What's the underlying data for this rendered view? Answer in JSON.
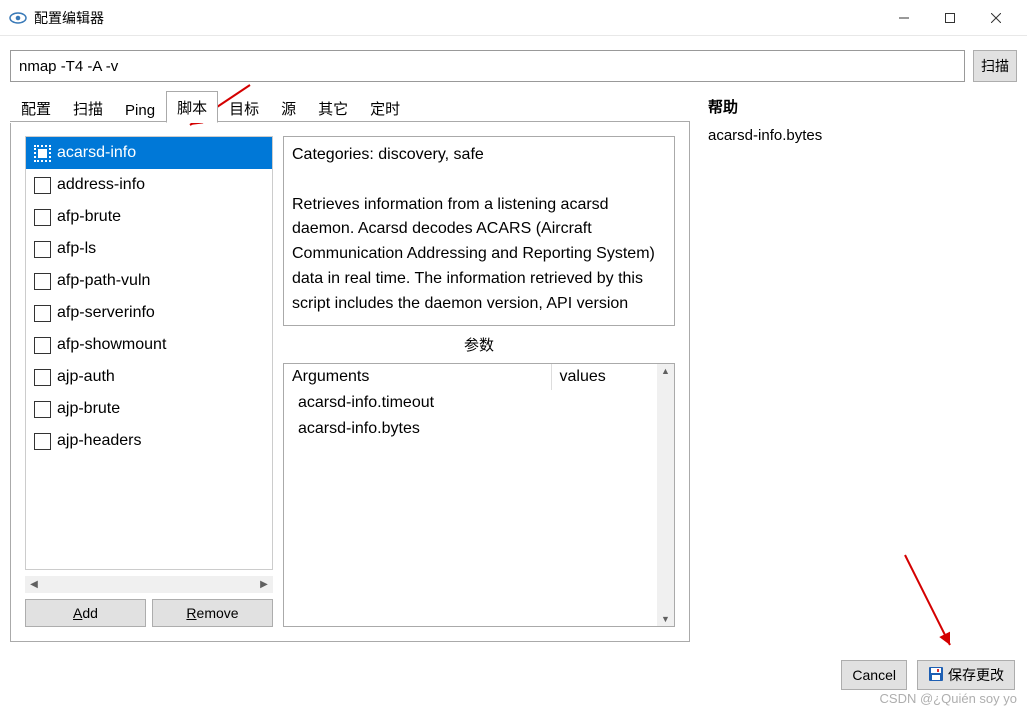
{
  "window": {
    "title": "配置编辑器"
  },
  "command": {
    "value": "nmap -T4 -A -v",
    "scan_label": "扫描"
  },
  "tabs": [
    "配置",
    "扫描",
    "Ping",
    "脚本",
    "目标",
    "源",
    "其它",
    "定时"
  ],
  "active_tab_index": 3,
  "scripts": [
    {
      "name": "acarsd-info",
      "selected": true
    },
    {
      "name": "address-info"
    },
    {
      "name": "afp-brute"
    },
    {
      "name": "afp-ls"
    },
    {
      "name": "afp-path-vuln"
    },
    {
      "name": "afp-serverinfo"
    },
    {
      "name": "afp-showmount"
    },
    {
      "name": "ajp-auth"
    },
    {
      "name": "ajp-brute"
    },
    {
      "name": "ajp-headers"
    }
  ],
  "buttons": {
    "add": "Add",
    "remove": "Remove",
    "cancel": "Cancel",
    "save": "保存更改"
  },
  "description": {
    "categories": "Categories: discovery, safe",
    "body": "Retrieves information from a listening acarsd daemon. Acarsd decodes ACARS (Aircraft Communication Addressing and Reporting System) data in real time.  The information retrieved by this script includes the daemon version, API version"
  },
  "params": {
    "title": "参数",
    "headers": {
      "arg": "Arguments",
      "val": "values"
    },
    "rows": [
      {
        "arg": "acarsd-info.timeout",
        "val": ""
      },
      {
        "arg": "acarsd-info.bytes",
        "val": ""
      }
    ]
  },
  "help": {
    "title": "帮助",
    "text": "acarsd-info.bytes"
  },
  "watermark": "CSDN @¿Quién soy yo"
}
